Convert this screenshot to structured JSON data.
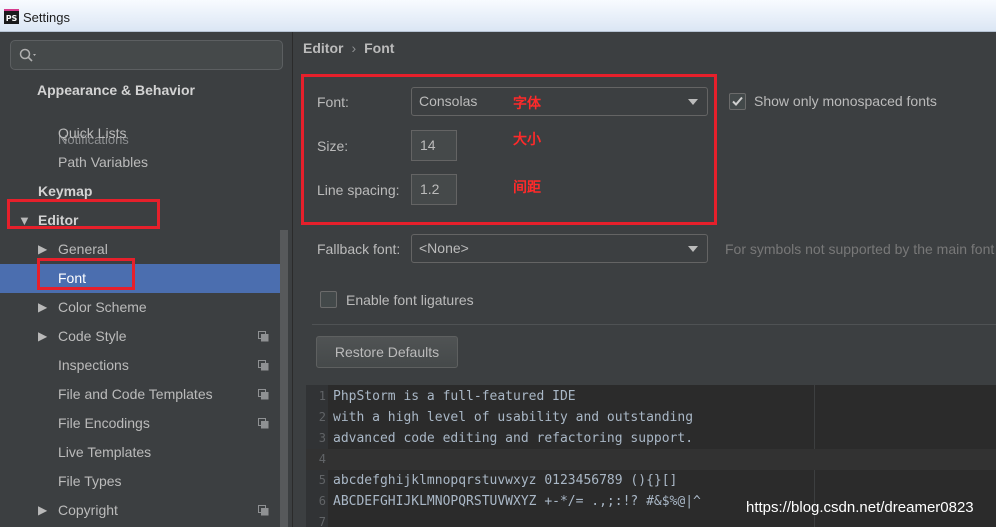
{
  "window": {
    "app_icon_text": "PS",
    "title": "Settings"
  },
  "sidebar": {
    "clipped_item": "Notifications",
    "items": [
      {
        "label": "Appearance & Behavior",
        "kind": "category"
      },
      {
        "label": "Quick Lists"
      },
      {
        "label": "Path Variables"
      },
      {
        "label": "Keymap",
        "kind": "category"
      },
      {
        "label": "Editor",
        "kind": "category",
        "expanded": true
      },
      {
        "label": "General",
        "expandable": true
      },
      {
        "label": "Font",
        "selected": true
      },
      {
        "label": "Color Scheme",
        "expandable": true
      },
      {
        "label": "Code Style",
        "expandable": true,
        "project_scoped": true
      },
      {
        "label": "Inspections",
        "project_scoped": true
      },
      {
        "label": "File and Code Templates",
        "project_scoped": true
      },
      {
        "label": "File Encodings",
        "project_scoped": true
      },
      {
        "label": "Live Templates"
      },
      {
        "label": "File Types"
      },
      {
        "label": "Copyright",
        "expandable": true,
        "project_scoped": true
      }
    ]
  },
  "breadcrumb": {
    "parent": "Editor",
    "separator": "›",
    "current": "Font"
  },
  "font_settings": {
    "font_label": "Font:",
    "font_value": "Consolas",
    "monospace_only_label": "Show only monospaced fonts",
    "monospace_only_checked": true,
    "size_label": "Size:",
    "size_value": "14",
    "line_spacing_label": "Line spacing:",
    "line_spacing_value": "1.2",
    "fallback_label": "Fallback font:",
    "fallback_value": "<None>",
    "fallback_hint": "For symbols not supported by the main font",
    "ligatures_label": "Enable font ligatures",
    "ligatures_checked": false,
    "restore_button": "Restore Defaults"
  },
  "annotations": {
    "font_note": "字体",
    "size_note": "大小",
    "spacing_note": "间距"
  },
  "preview": {
    "lines": [
      {
        "num": "1",
        "text": "PhpStorm is a full-featured IDE"
      },
      {
        "num": "2",
        "text": "with a high level of usability and outstanding"
      },
      {
        "num": "3",
        "text": "advanced code editing and refactoring support."
      },
      {
        "num": "4",
        "text": ""
      },
      {
        "num": "5",
        "text": "abcdefghijklmnopqrstuvwxyz 0123456789 (){}[]"
      },
      {
        "num": "6",
        "text": "ABCDEFGHIJKLMNOPQRSTUVWXYZ +-*/= .,;:!? #&$%@|^"
      },
      {
        "num": "7",
        "text": ""
      }
    ]
  },
  "watermark": "https://blog.csdn.net/dreamer0823",
  "colors": {
    "background": "#3c3f41",
    "selection": "#4b6eaf",
    "annotation_red": "#e6202b",
    "editor_background": "#2b2b2b"
  }
}
